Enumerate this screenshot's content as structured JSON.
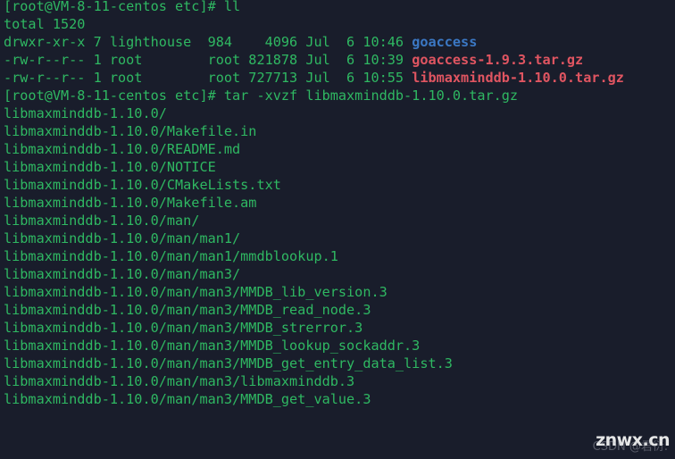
{
  "terminal": {
    "background_color": "#191d2b",
    "foreground_color": "#2fb862",
    "dir_color": "#3b78c4",
    "archive_color": "#e05561",
    "prompt": "[root@VM-8-11-centos etc]#",
    "lines": [
      {
        "id": "line-prompt-ll",
        "segments": [
          {
            "text": "[root@VM-8-11-centos etc]# ll",
            "color": "green"
          }
        ]
      },
      {
        "id": "line-total",
        "segments": [
          {
            "text": "total 1520",
            "color": "green"
          }
        ]
      },
      {
        "id": "line-listing-goaccess-dir",
        "segments": [
          {
            "text": "drwxr-xr-x 7 lighthouse  984    4096 Jul  6 10:46 ",
            "color": "green"
          },
          {
            "text": "goaccess",
            "color": "blue"
          }
        ]
      },
      {
        "id": "line-listing-goaccess-tar",
        "segments": [
          {
            "text": "-rw-r--r-- 1 root        root 821878 Jul  6 10:39 ",
            "color": "green"
          },
          {
            "text": "goaccess-1.9.3.tar.gz",
            "color": "red"
          }
        ]
      },
      {
        "id": "line-listing-libmaxminddb-tar",
        "segments": [
          {
            "text": "-rw-r--r-- 1 root        root 727713 Jul  6 10:55 ",
            "color": "green"
          },
          {
            "text": "libmaxminddb-1.10.0.tar.gz",
            "color": "red"
          }
        ]
      },
      {
        "id": "line-prompt-tar",
        "segments": [
          {
            "text": "[root@VM-8-11-centos etc]# tar -xvzf libmaxminddb-1.10.0.tar.gz",
            "color": "green"
          }
        ]
      },
      {
        "id": "line-out-1",
        "segments": [
          {
            "text": "libmaxminddb-1.10.0/",
            "color": "green"
          }
        ]
      },
      {
        "id": "line-out-2",
        "segments": [
          {
            "text": "libmaxminddb-1.10.0/Makefile.in",
            "color": "green"
          }
        ]
      },
      {
        "id": "line-out-3",
        "segments": [
          {
            "text": "libmaxminddb-1.10.0/README.md",
            "color": "green"
          }
        ]
      },
      {
        "id": "line-out-4",
        "segments": [
          {
            "text": "libmaxminddb-1.10.0/NOTICE",
            "color": "green"
          }
        ]
      },
      {
        "id": "line-out-5",
        "segments": [
          {
            "text": "libmaxminddb-1.10.0/CMakeLists.txt",
            "color": "green"
          }
        ]
      },
      {
        "id": "line-out-6",
        "segments": [
          {
            "text": "libmaxminddb-1.10.0/Makefile.am",
            "color": "green"
          }
        ]
      },
      {
        "id": "line-out-7",
        "segments": [
          {
            "text": "libmaxminddb-1.10.0/man/",
            "color": "green"
          }
        ]
      },
      {
        "id": "line-out-8",
        "segments": [
          {
            "text": "libmaxminddb-1.10.0/man/man1/",
            "color": "green"
          }
        ]
      },
      {
        "id": "line-out-9",
        "segments": [
          {
            "text": "libmaxminddb-1.10.0/man/man1/mmdblookup.1",
            "color": "green"
          }
        ]
      },
      {
        "id": "line-out-10",
        "segments": [
          {
            "text": "libmaxminddb-1.10.0/man/man3/",
            "color": "green"
          }
        ]
      },
      {
        "id": "line-out-11",
        "segments": [
          {
            "text": "libmaxminddb-1.10.0/man/man3/MMDB_lib_version.3",
            "color": "green"
          }
        ]
      },
      {
        "id": "line-out-12",
        "segments": [
          {
            "text": "libmaxminddb-1.10.0/man/man3/MMDB_read_node.3",
            "color": "green"
          }
        ]
      },
      {
        "id": "line-out-13",
        "segments": [
          {
            "text": "libmaxminddb-1.10.0/man/man3/MMDB_strerror.3",
            "color": "green"
          }
        ]
      },
      {
        "id": "line-out-14",
        "segments": [
          {
            "text": "libmaxminddb-1.10.0/man/man3/MMDB_lookup_sockaddr.3",
            "color": "green"
          }
        ]
      },
      {
        "id": "line-out-15",
        "segments": [
          {
            "text": "libmaxminddb-1.10.0/man/man3/MMDB_get_entry_data_list.3",
            "color": "green"
          }
        ]
      },
      {
        "id": "line-out-16",
        "segments": [
          {
            "text": "libmaxminddb-1.10.0/man/man3/libmaxminddb.3",
            "color": "green"
          }
        ]
      },
      {
        "id": "line-out-17-clipped",
        "segments": [
          {
            "text": "libmaxminddb-1.10.0/man/man3/MMDB_get_value.3",
            "color": "green"
          }
        ]
      }
    ]
  },
  "watermark": {
    "primary": "znwx.cn",
    "secondary": "CSDN @君衍."
  }
}
